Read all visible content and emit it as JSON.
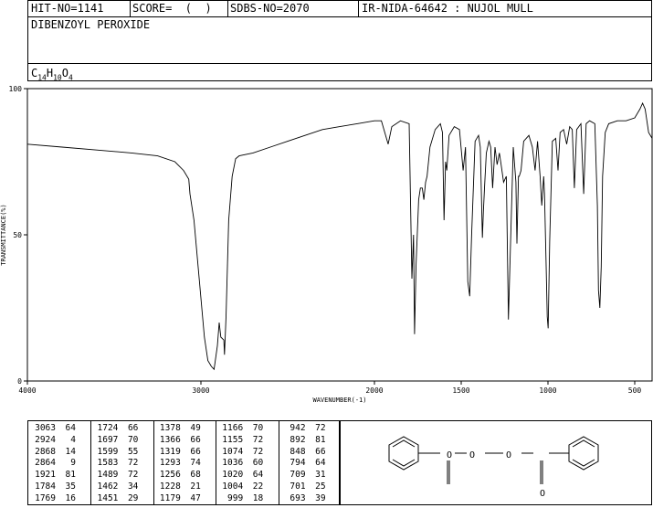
{
  "header": {
    "hit_no": "HIT-NO=1141",
    "score": "SCORE=  (  )",
    "sdbs_no": "SDBS-NO=2070",
    "ir_info": "IR-NIDA-64642 : NUJOL MULL",
    "compound_name": "DIBENZOYL PEROXIDE",
    "formula_c": "C",
    "formula_c_sub": "14",
    "formula_h": "H",
    "formula_h_sub": "10",
    "formula_o": "O",
    "formula_o_sub": "4"
  },
  "chart_data": {
    "type": "line",
    "xlabel": "WAVENUMBER(-1)",
    "ylabel": "TRANSMITTANCE(%)",
    "xlim": [
      4000,
      400
    ],
    "ylim": [
      0,
      100
    ],
    "x_ticks": [
      4000,
      3000,
      2000,
      1500,
      1000,
      500
    ],
    "y_ticks": [
      0,
      50,
      100
    ],
    "x_tick_labels": [
      "4000",
      "3000",
      "2000",
      "1500",
      "1000",
      "500"
    ],
    "y_tick_labels": [
      "0",
      "50",
      "100"
    ],
    "series": [
      {
        "points": [
          [
            4000,
            81
          ],
          [
            3800,
            80
          ],
          [
            3600,
            79
          ],
          [
            3400,
            78
          ],
          [
            3250,
            77
          ],
          [
            3150,
            75
          ],
          [
            3100,
            72
          ],
          [
            3070,
            69
          ],
          [
            3063,
            64
          ],
          [
            3040,
            55
          ],
          [
            3010,
            35
          ],
          [
            2980,
            15
          ],
          [
            2960,
            7
          ],
          [
            2940,
            5
          ],
          [
            2924,
            4
          ],
          [
            2905,
            12
          ],
          [
            2895,
            20
          ],
          [
            2885,
            15
          ],
          [
            2868,
            14
          ],
          [
            2864,
            9
          ],
          [
            2855,
            22
          ],
          [
            2840,
            55
          ],
          [
            2820,
            70
          ],
          [
            2800,
            76
          ],
          [
            2780,
            77
          ],
          [
            2700,
            78
          ],
          [
            2600,
            80
          ],
          [
            2500,
            82
          ],
          [
            2400,
            84
          ],
          [
            2300,
            86
          ],
          [
            2200,
            87
          ],
          [
            2100,
            88
          ],
          [
            2000,
            89
          ],
          [
            1960,
            89
          ],
          [
            1921,
            81
          ],
          [
            1900,
            87
          ],
          [
            1850,
            89
          ],
          [
            1800,
            88
          ],
          [
            1784,
            35
          ],
          [
            1775,
            50
          ],
          [
            1769,
            16
          ],
          [
            1760,
            40
          ],
          [
            1745,
            62
          ],
          [
            1735,
            66
          ],
          [
            1724,
            66
          ],
          [
            1715,
            62
          ],
          [
            1705,
            68
          ],
          [
            1697,
            70
          ],
          [
            1680,
            80
          ],
          [
            1650,
            86
          ],
          [
            1620,
            88
          ],
          [
            1608,
            85
          ],
          [
            1599,
            55
          ],
          [
            1590,
            75
          ],
          [
            1583,
            72
          ],
          [
            1570,
            84
          ],
          [
            1540,
            87
          ],
          [
            1510,
            86
          ],
          [
            1489,
            72
          ],
          [
            1475,
            80
          ],
          [
            1462,
            34
          ],
          [
            1451,
            29
          ],
          [
            1440,
            50
          ],
          [
            1420,
            82
          ],
          [
            1400,
            84
          ],
          [
            1390,
            80
          ],
          [
            1378,
            49
          ],
          [
            1372,
            58
          ],
          [
            1366,
            66
          ],
          [
            1355,
            78
          ],
          [
            1340,
            82
          ],
          [
            1330,
            80
          ],
          [
            1319,
            66
          ],
          [
            1305,
            80
          ],
          [
            1293,
            74
          ],
          [
            1280,
            78
          ],
          [
            1270,
            74
          ],
          [
            1256,
            68
          ],
          [
            1240,
            70
          ],
          [
            1228,
            21
          ],
          [
            1215,
            48
          ],
          [
            1200,
            80
          ],
          [
            1185,
            68
          ],
          [
            1179,
            47
          ],
          [
            1170,
            70
          ],
          [
            1166,
            70
          ],
          [
            1155,
            72
          ],
          [
            1140,
            82
          ],
          [
            1110,
            84
          ],
          [
            1090,
            80
          ],
          [
            1074,
            72
          ],
          [
            1060,
            82
          ],
          [
            1045,
            70
          ],
          [
            1036,
            60
          ],
          [
            1025,
            70
          ],
          [
            1020,
            64
          ],
          [
            1010,
            38
          ],
          [
            1004,
            22
          ],
          [
            999,
            18
          ],
          [
            990,
            48
          ],
          [
            975,
            82
          ],
          [
            955,
            83
          ],
          [
            942,
            72
          ],
          [
            930,
            85
          ],
          [
            910,
            86
          ],
          [
            892,
            81
          ],
          [
            875,
            87
          ],
          [
            860,
            86
          ],
          [
            848,
            66
          ],
          [
            835,
            86
          ],
          [
            810,
            88
          ],
          [
            794,
            64
          ],
          [
            780,
            88
          ],
          [
            760,
            89
          ],
          [
            730,
            88
          ],
          [
            715,
            60
          ],
          [
            709,
            31
          ],
          [
            701,
            25
          ],
          [
            693,
            39
          ],
          [
            685,
            70
          ],
          [
            670,
            85
          ],
          [
            650,
            88
          ],
          [
            600,
            89
          ],
          [
            550,
            89
          ],
          [
            500,
            90
          ],
          [
            470,
            93
          ],
          [
            455,
            95
          ],
          [
            440,
            93
          ],
          [
            420,
            85
          ],
          [
            400,
            83
          ]
        ]
      }
    ],
    "peaks": [
      [
        3063,
        64
      ],
      [
        2924,
        4
      ],
      [
        2868,
        14
      ],
      [
        2864,
        9
      ],
      [
        1921,
        81
      ],
      [
        1784,
        35
      ],
      [
        1769,
        16
      ],
      [
        1724,
        66
      ],
      [
        1697,
        70
      ],
      [
        1599,
        55
      ],
      [
        1583,
        72
      ],
      [
        1489,
        72
      ],
      [
        1462,
        34
      ],
      [
        1451,
        29
      ],
      [
        1378,
        49
      ],
      [
        1366,
        66
      ],
      [
        1319,
        66
      ],
      [
        1293,
        74
      ],
      [
        1256,
        68
      ],
      [
        1228,
        21
      ],
      [
        1179,
        47
      ],
      [
        1166,
        70
      ],
      [
        1155,
        72
      ],
      [
        1074,
        72
      ],
      [
        1036,
        60
      ],
      [
        1020,
        64
      ],
      [
        1004,
        22
      ],
      [
        999,
        18
      ],
      [
        942,
        72
      ],
      [
        892,
        81
      ],
      [
        848,
        66
      ],
      [
        794,
        64
      ],
      [
        709,
        31
      ],
      [
        701,
        25
      ],
      [
        693,
        39
      ]
    ]
  },
  "structure": {
    "o_label_1": "O",
    "o_label_2": "O",
    "o_label_3": "O",
    "o_label_4": "O"
  }
}
